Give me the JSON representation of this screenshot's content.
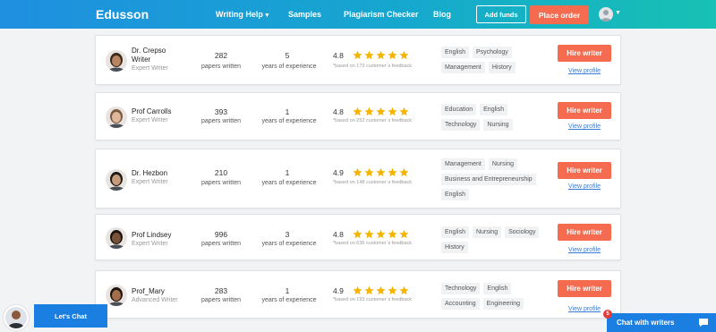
{
  "nav": {
    "logo": "Edusson",
    "links": [
      "Writing Help",
      "Samples",
      "Plagiarism Checker",
      "Blog"
    ],
    "add_funds": "Add funds",
    "place_order": "Place order"
  },
  "writers": [
    {
      "name": "Dr. Crepso Writer",
      "level": "Expert Writer",
      "papers": "282",
      "papers_label": "papers written",
      "years": "5",
      "years_label": "years of  experience",
      "rating": "4.8",
      "stars": 5,
      "feedback": "*based on 173 customer`s feedback",
      "tags": [
        "English",
        "Psychology",
        "Management",
        "History"
      ],
      "hire": "Hire writer",
      "view": "View profile",
      "skin": "#b88560",
      "hair": "#3b2a1e"
    },
    {
      "name": "Prof Carrolls",
      "level": "Expert Writer",
      "papers": "393",
      "papers_label": "papers written",
      "years": "1",
      "years_label": "years of  experience",
      "rating": "4.8",
      "stars": 5,
      "feedback": "*based on 252 customer`s feedback",
      "tags": [
        "Education",
        "English",
        "Technology",
        "Nursing"
      ],
      "hire": "Hire writer",
      "view": "View profile",
      "skin": "#e0b79a",
      "hair": "#7a5a40"
    },
    {
      "name": "Dr. Hezbon",
      "level": "Expert Writer",
      "papers": "210",
      "papers_label": "papers written",
      "years": "1",
      "years_label": "years of  experience",
      "rating": "4.9",
      "stars": 5,
      "feedback": "*based on 148 customer`s feedback",
      "tags": [
        "Management",
        "Nursing",
        "Business and Entrepreneurship",
        "English"
      ],
      "hire": "Hire writer",
      "view": "View profile",
      "skin": "#c79b78",
      "hair": "#1e1a18"
    },
    {
      "name": "Prof Lindsey",
      "level": "Expert Writer",
      "papers": "996",
      "papers_label": "papers written",
      "years": "3",
      "years_label": "years of  experience",
      "rating": "4.8",
      "stars": 5,
      "feedback": "*based on 636 customer`s feedback",
      "tags": [
        "English",
        "Nursing",
        "Sociology",
        "History"
      ],
      "hire": "Hire writer",
      "view": "View profile",
      "skin": "#7a5238",
      "hair": "#1b1410"
    },
    {
      "name": "Prof_Mary",
      "level": "Advanced Writer",
      "papers": "283",
      "papers_label": "papers written",
      "years": "1",
      "years_label": "years of  experience",
      "rating": "4.9",
      "stars": 5,
      "feedback": "*based on 193 customer`s feedback",
      "tags": [
        "Technology",
        "English",
        "Accounting",
        "Engineering"
      ],
      "hire": "Hire writer",
      "view": "View profile",
      "skin": "#a56d49",
      "hair": "#1b1410"
    }
  ],
  "chat": {
    "lets_chat": "Let's Chat",
    "chat_with_writers": "Chat with writers",
    "badge": "5"
  },
  "colors": {
    "accent": "#f46b4f",
    "nav_start": "#1f8fe0",
    "nav_end": "#17c1b3",
    "star": "#f5b400",
    "link": "#3a7bd5"
  }
}
